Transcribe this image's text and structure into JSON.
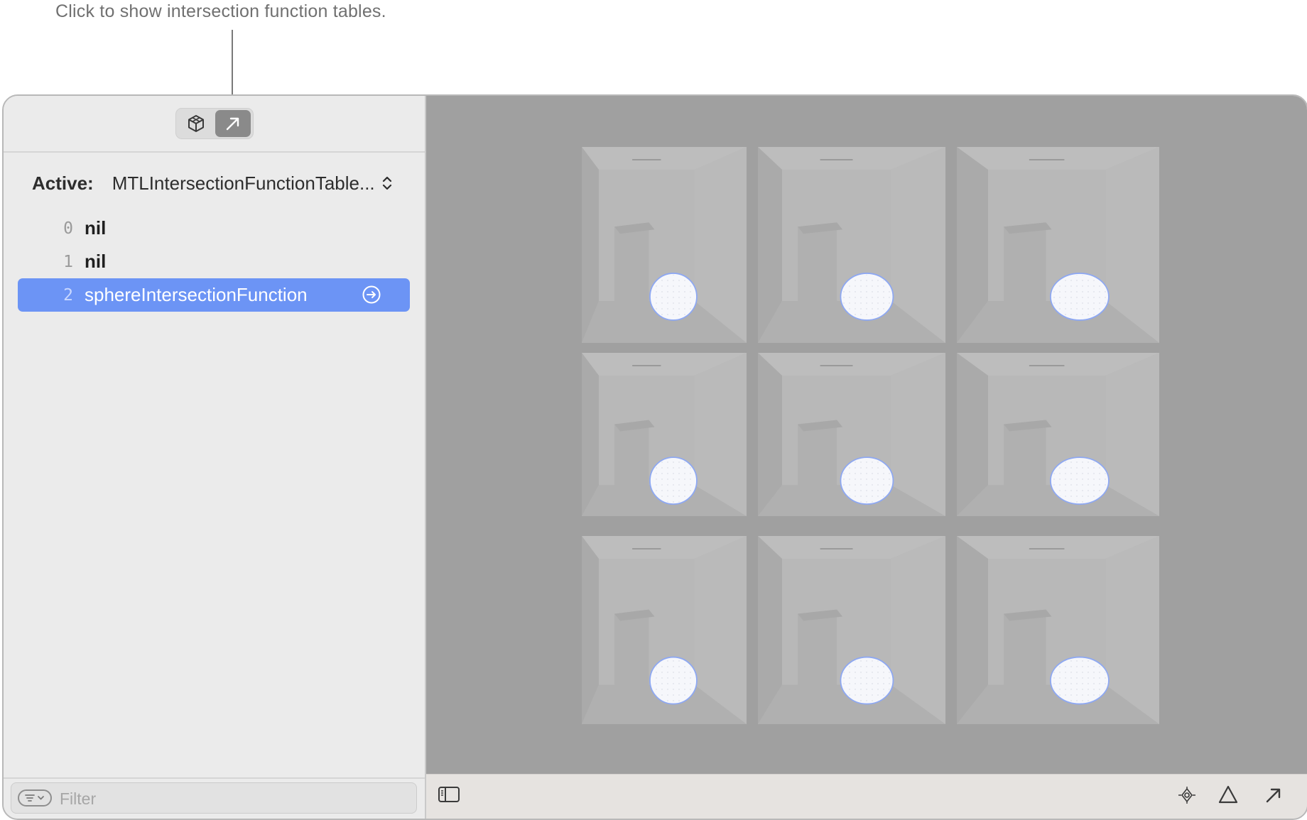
{
  "callout": {
    "text": "Click to show intersection function tables."
  },
  "sidebar": {
    "segments": [
      {
        "icon": "acceleration-structure-icon",
        "selected": false
      },
      {
        "icon": "arrow-up-right-icon",
        "selected": true
      }
    ],
    "active_label": "Active:",
    "active_value": "MTLIntersectionFunctionTable...",
    "rows": [
      {
        "index": "0",
        "name": "nil",
        "selected": false
      },
      {
        "index": "1",
        "name": "nil",
        "selected": false
      },
      {
        "index": "2",
        "name": "sphereIntersectionFunction",
        "selected": true
      }
    ],
    "filter": {
      "placeholder": "Filter",
      "value": ""
    }
  },
  "bottombar": {
    "icons": [
      "sidebar-toggle-icon",
      "focus-icon",
      "triangle-icon",
      "arrow-up-right-icon"
    ]
  },
  "colors": {
    "selection": "#6c94f5",
    "viewport_background": "#a0a0a0",
    "sidebar_background": "#ebebeb"
  }
}
